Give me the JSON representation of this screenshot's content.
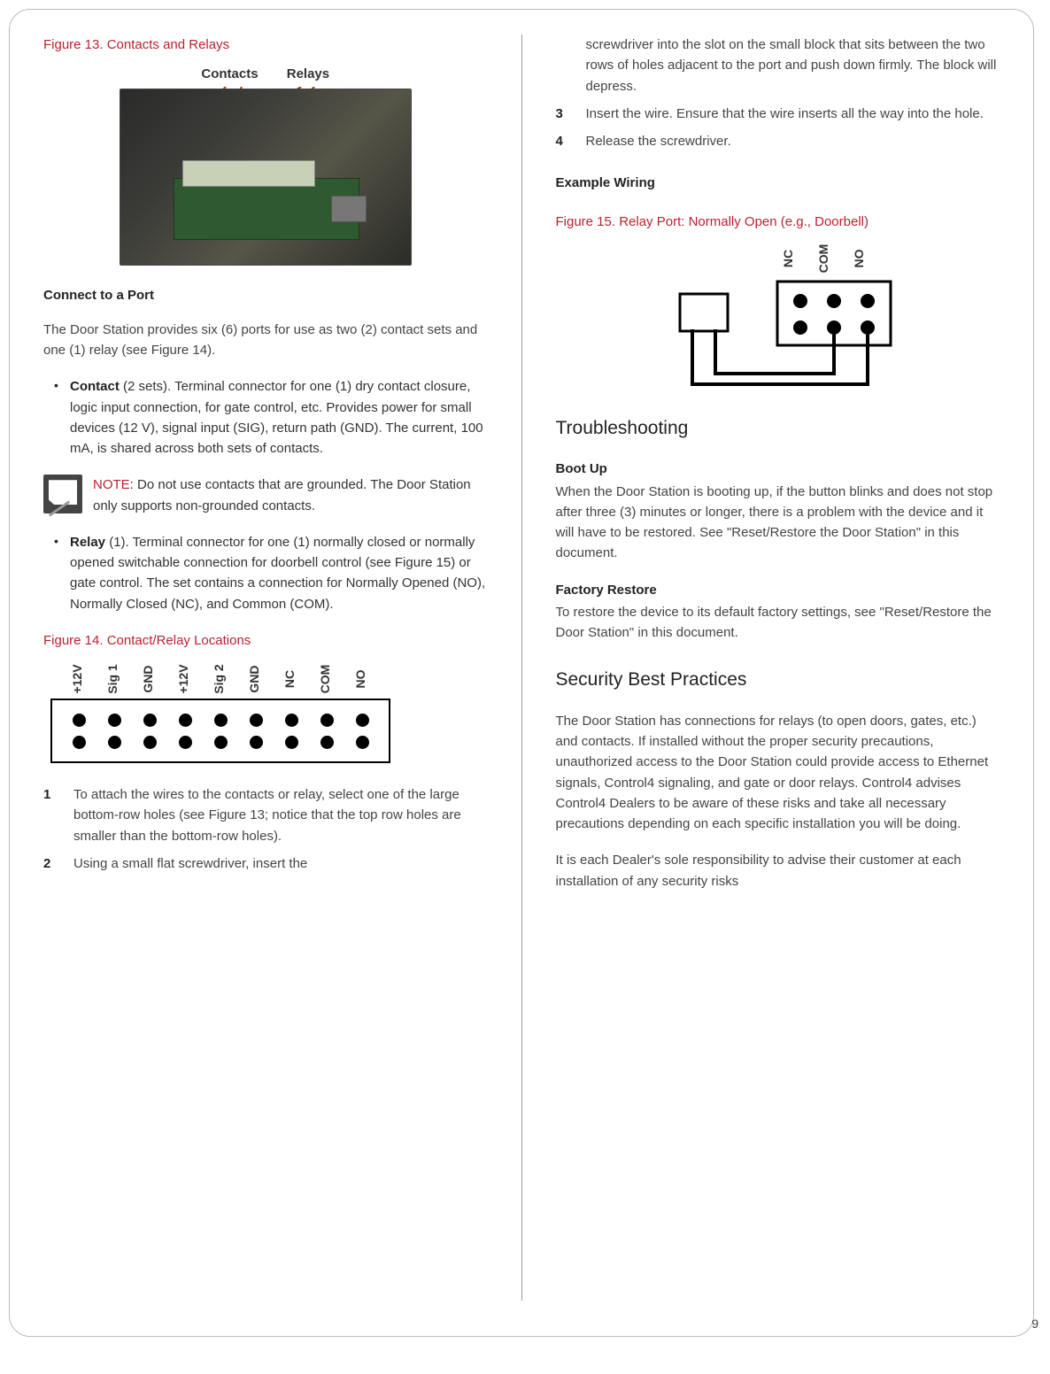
{
  "page_number": "9",
  "left": {
    "fig13_caption": "Figure 13. Contacts and Relays",
    "fig13_label_contacts": "Contacts",
    "fig13_label_relays": "Relays",
    "connect_heading": "Connect to a Port",
    "connect_intro": "The Door Station provides six (6) ports for use as two (2) contact sets and one (1) relay (see Figure 14).",
    "bullet_contact_lead": "Contact",
    "bullet_contact_body": " (2 sets). Terminal connector for one (1) dry contact closure, logic input connection, for gate control, etc. Provides power for small devices (12 V), signal input (SIG), return path (GND). The current, 100 mA, is shared across both sets of contacts.",
    "note_lead": "NOTE",
    "note_body": ": Do not use contacts that are grounded. The Door Station only supports non-grounded contacts.",
    "bullet_relay_lead": "Relay",
    "bullet_relay_body": " (1). Terminal connector for one (1) normally closed or normally opened switchable connection for doorbell control (see Figure 15) or gate control. The set contains a connection for Normally Opened (NO), Normally Closed (NC), and Common (COM).",
    "fig14_caption": "Figure 14. Contact/Relay Locations",
    "fig14_pins": [
      "+12V",
      "Sig 1",
      "GND",
      "+12V",
      "Sig 2",
      "GND",
      "NC",
      "COM",
      "NO"
    ],
    "step1": "To attach the wires to the contacts or relay, select one of the large bottom-row holes (see Figure 13; notice that the top row holes are smaller than the bottom-row holes).",
    "step2": "Using a small flat screwdriver, insert the"
  },
  "right": {
    "step2_cont": "screwdriver into the slot on the small block that sits between the two rows of holes adjacent to the port and push down firmly. The block will depress.",
    "step3": "Insert the wire. Ensure that the wire inserts all the way into the hole.",
    "step4": "Release the screwdriver.",
    "example_wiring_heading": "Example Wiring",
    "fig15_caption": "Figure 15. Relay Port: Normally Open (e.g., Doorbell)",
    "fig15_pins": [
      "NC",
      "COM",
      "NO"
    ],
    "troubleshooting_heading": "Troubleshooting",
    "bootup_lead": "Boot Up",
    "bootup_body": "When the Door Station is booting up, if the button blinks and does not stop after three (3) minutes or longer, there is a problem with the device and it will have to be restored. See \"Reset/Restore the Door Station\" in this document.",
    "factory_lead": "Factory Restore",
    "factory_body": "To restore the device to its default factory settings, see \"Reset/Restore the Door Station\" in this document.",
    "security_heading": "Security Best Practices",
    "security_p1": "The Door Station has connections for relays (to open doors, gates, etc.) and contacts. If installed without the proper security precautions, unauthorized access to the Door Station could provide access to Ethernet signals, Control4 signaling, and gate or door relays. Control4 advises Control4 Dealers to be aware of these risks and take all necessary precautions depending on each specific installation you will be doing.",
    "security_p2": "It is each Dealer's sole responsibility to advise their customer at each installation of any security risks"
  }
}
